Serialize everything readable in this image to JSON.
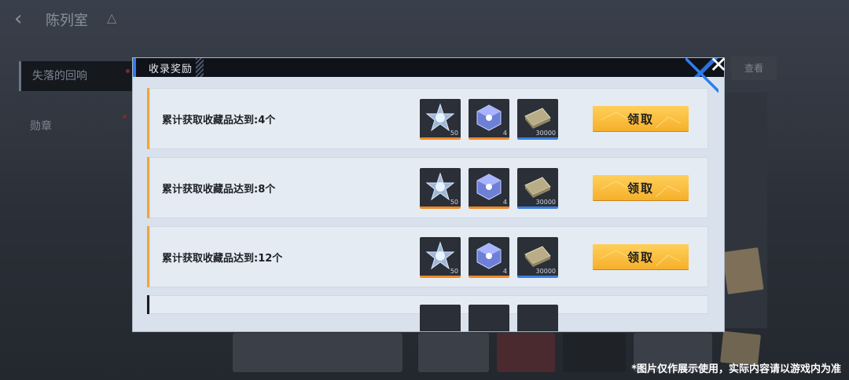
{
  "background": {
    "title": "陈列室",
    "sidebar": [
      "失落的回响",
      "勋章"
    ],
    "right_button": "查看"
  },
  "dialog": {
    "title": "收录奖励",
    "rows": [
      {
        "label": "累计获取收藏品达到:4个",
        "rewards": [
          {
            "icon": "star-crystal-icon",
            "qty": "50"
          },
          {
            "icon": "cube-crystal-icon",
            "qty": "4"
          },
          {
            "icon": "cash-stack-icon",
            "qty": "30000"
          }
        ],
        "button": "领取"
      },
      {
        "label": "累计获取收藏品达到:8个",
        "rewards": [
          {
            "icon": "star-crystal-icon",
            "qty": "50"
          },
          {
            "icon": "cube-crystal-icon",
            "qty": "4"
          },
          {
            "icon": "cash-stack-icon",
            "qty": "30000"
          }
        ],
        "button": "领取"
      },
      {
        "label": "累计获取收藏品达到:12个",
        "rewards": [
          {
            "icon": "star-crystal-icon",
            "qty": "50"
          },
          {
            "icon": "cube-crystal-icon",
            "qty": "4"
          },
          {
            "icon": "cash-stack-icon",
            "qty": "30000"
          }
        ],
        "button": "领取"
      }
    ]
  },
  "close_glyph": "✕",
  "footer_note": "*图片仅作展示使用，实际内容请以游戏内为准",
  "colors": {
    "accent_blue": "#2f7df0",
    "button_yellow": "#f6b02a",
    "row_accent": "#f0a53a",
    "rarity_orange": "#f08a24",
    "rarity_blue": "#3b7fe0"
  }
}
